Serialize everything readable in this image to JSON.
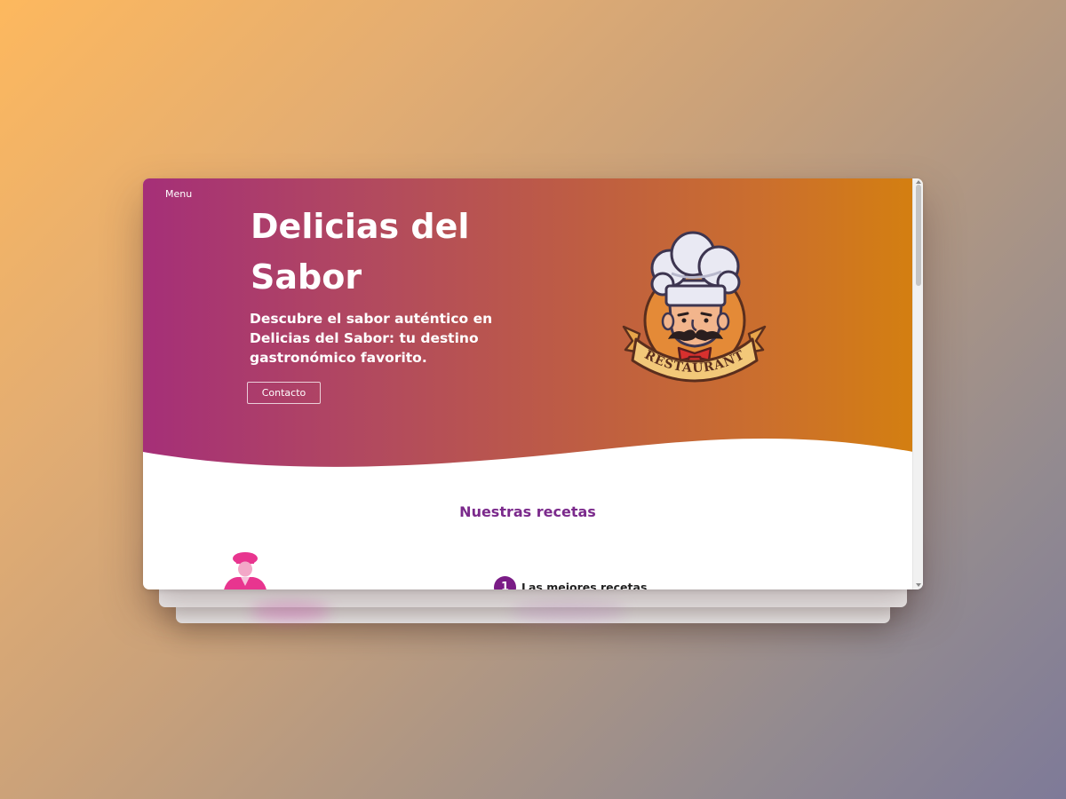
{
  "nav": {
    "menu_label": "Menu"
  },
  "hero": {
    "title": "Delicias del Sabor",
    "subtitle": "Descubre el sabor auténtico en Delicias del Sabor: tu destino gastronómico favorito.",
    "contact_button": "Contacto",
    "logo_text": "RESTAURANT"
  },
  "recipes": {
    "section_title": "Nuestras recetas",
    "items": [
      {
        "number": "1",
        "label": "Las mejores recetas"
      }
    ]
  },
  "theme": {
    "gradient_start": "#a52f78",
    "gradient_end": "#d4800f",
    "accent_purple": "#7b2a8c",
    "chef_pink": "#e8358f"
  },
  "icons": {
    "logo": "chef-restaurant-logo",
    "chef": "chef-figure-icon"
  }
}
